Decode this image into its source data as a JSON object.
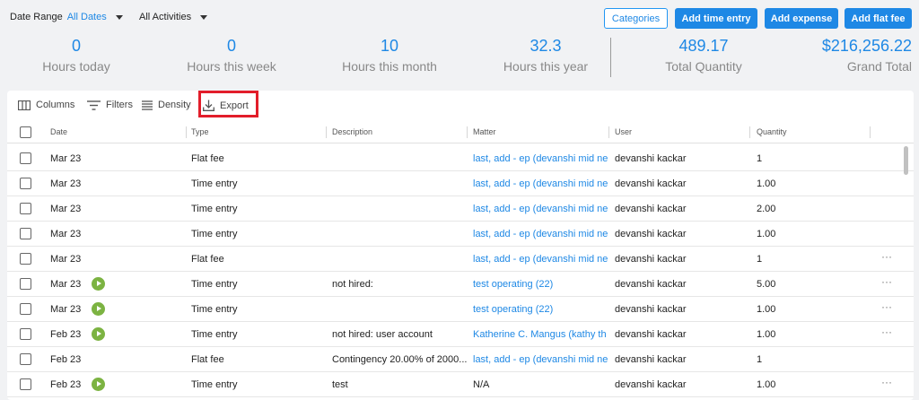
{
  "filters": {
    "date_range_label": "Date Range",
    "date_range_value": "All Dates",
    "activities_label": "All Activities"
  },
  "buttons": {
    "categories": "Categories",
    "add_time_entry": "Add time entry",
    "add_expense": "Add expense",
    "add_flat_fee": "Add flat fee"
  },
  "stats": [
    {
      "value": "0",
      "label": "Hours today"
    },
    {
      "value": "0",
      "label": "Hours this week"
    },
    {
      "value": "10",
      "label": "Hours this month"
    },
    {
      "value": "32.3",
      "label": "Hours this year"
    },
    {
      "value": "489.17",
      "label": "Total Quantity"
    },
    {
      "value": "$216,256.22",
      "label": "Grand Total"
    }
  ],
  "toolbar": {
    "columns": "Columns",
    "filters": "Filters",
    "density": "Density",
    "export": "Export"
  },
  "table": {
    "headers": [
      "Date",
      "Type",
      "Description",
      "Matter",
      "User",
      "Quantity"
    ],
    "rows": [
      {
        "date": "Mar 23",
        "type": "Flat fee",
        "description": "",
        "matter": "last, add - ep (devanshi mid ne",
        "user": "devanshi kackar",
        "quantity": "1"
      },
      {
        "date": "Mar 23",
        "type": "Time entry",
        "description": "",
        "matter": "last, add - ep (devanshi mid ne",
        "user": "devanshi kackar",
        "quantity": "1.00"
      },
      {
        "date": "Mar 23",
        "type": "Time entry",
        "description": "",
        "matter": "last, add - ep (devanshi mid ne",
        "user": "devanshi kackar",
        "quantity": "2.00"
      },
      {
        "date": "Mar 23",
        "type": "Time entry",
        "description": "",
        "matter": "last, add - ep (devanshi mid ne",
        "user": "devanshi kackar",
        "quantity": "1.00"
      },
      {
        "date": "Mar 23",
        "type": "Flat fee",
        "description": "",
        "matter": "last, add - ep (devanshi mid ne",
        "user": "devanshi kackar",
        "quantity": "1"
      },
      {
        "date": "Mar 23",
        "type": "Time entry",
        "description": "not hired:",
        "matter": "test operating (22)",
        "user": "devanshi kackar",
        "quantity": "5.00"
      },
      {
        "date": "Mar 23",
        "type": "Time entry",
        "description": "",
        "matter": "test operating (22)",
        "user": "devanshi kackar",
        "quantity": "1.00"
      },
      {
        "date": "Feb 23",
        "type": "Time entry",
        "description": "not hired: user account",
        "matter": "Katherine C. Mangus (kathy th",
        "user": "devanshi kackar",
        "quantity": "1.00"
      },
      {
        "date": "Feb 23",
        "type": "Flat fee",
        "description": "Contingency 20.00% of 2000...",
        "matter": "last, add - ep (devanshi mid ne",
        "user": "devanshi kackar",
        "quantity": "1"
      },
      {
        "date": "Feb 23",
        "type": "Time entry",
        "description": "test",
        "matter": "N/A",
        "user": "devanshi kackar",
        "quantity": "1.00"
      }
    ],
    "more_label": "···"
  },
  "colors": {
    "accent": "#1e88e5",
    "play": "#7cb342",
    "highlight": "#e21d2a"
  }
}
